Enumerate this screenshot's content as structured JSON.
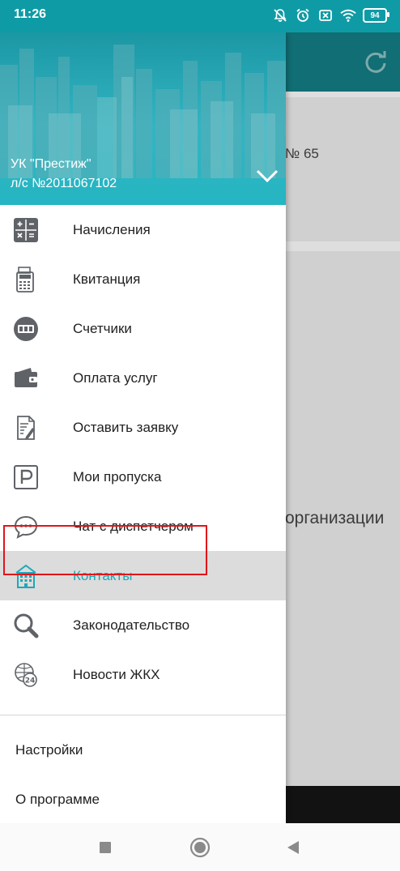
{
  "status_bar": {
    "time": "11:26",
    "battery": "94",
    "icons": [
      "bell-off-icon",
      "alarm-icon",
      "sim-x-icon",
      "wifi-icon",
      "battery-icon"
    ]
  },
  "background_app": {
    "number_text": "№ 65",
    "org_text": "организации",
    "refresh_icon": "refresh-icon"
  },
  "drawer": {
    "header": {
      "org": "УК \"Престиж\"",
      "account": "л/с №2011067102",
      "chevron_icon": "chevron-down-icon"
    },
    "menu": [
      {
        "label": "Начисления",
        "icon": "calculator-icon"
      },
      {
        "label": "Квитанция",
        "icon": "receipt-icon"
      },
      {
        "label": "Счетчики",
        "icon": "meter-icon"
      },
      {
        "label": "Оплата услуг",
        "icon": "wallet-icon"
      },
      {
        "label": "Оставить заявку",
        "icon": "request-icon"
      },
      {
        "label": "Мои пропуска",
        "icon": "parking-icon"
      },
      {
        "label": "Чат с диспетчером",
        "icon": "chat-icon"
      },
      {
        "label": "Контакты",
        "icon": "building-icon",
        "active": true
      },
      {
        "label": "Законодательство",
        "icon": "magnifier-icon"
      },
      {
        "label": "Новости ЖКХ",
        "icon": "news-24-icon"
      }
    ],
    "bottom": [
      {
        "label": "Настройки"
      },
      {
        "label": "О программе"
      }
    ]
  },
  "nav_bar": [
    "recents-button",
    "home-button",
    "back-button"
  ],
  "colors": {
    "accent": "#1fa8b8",
    "status_bar": "#0f9ba5",
    "highlight_border": "#e0161a"
  }
}
